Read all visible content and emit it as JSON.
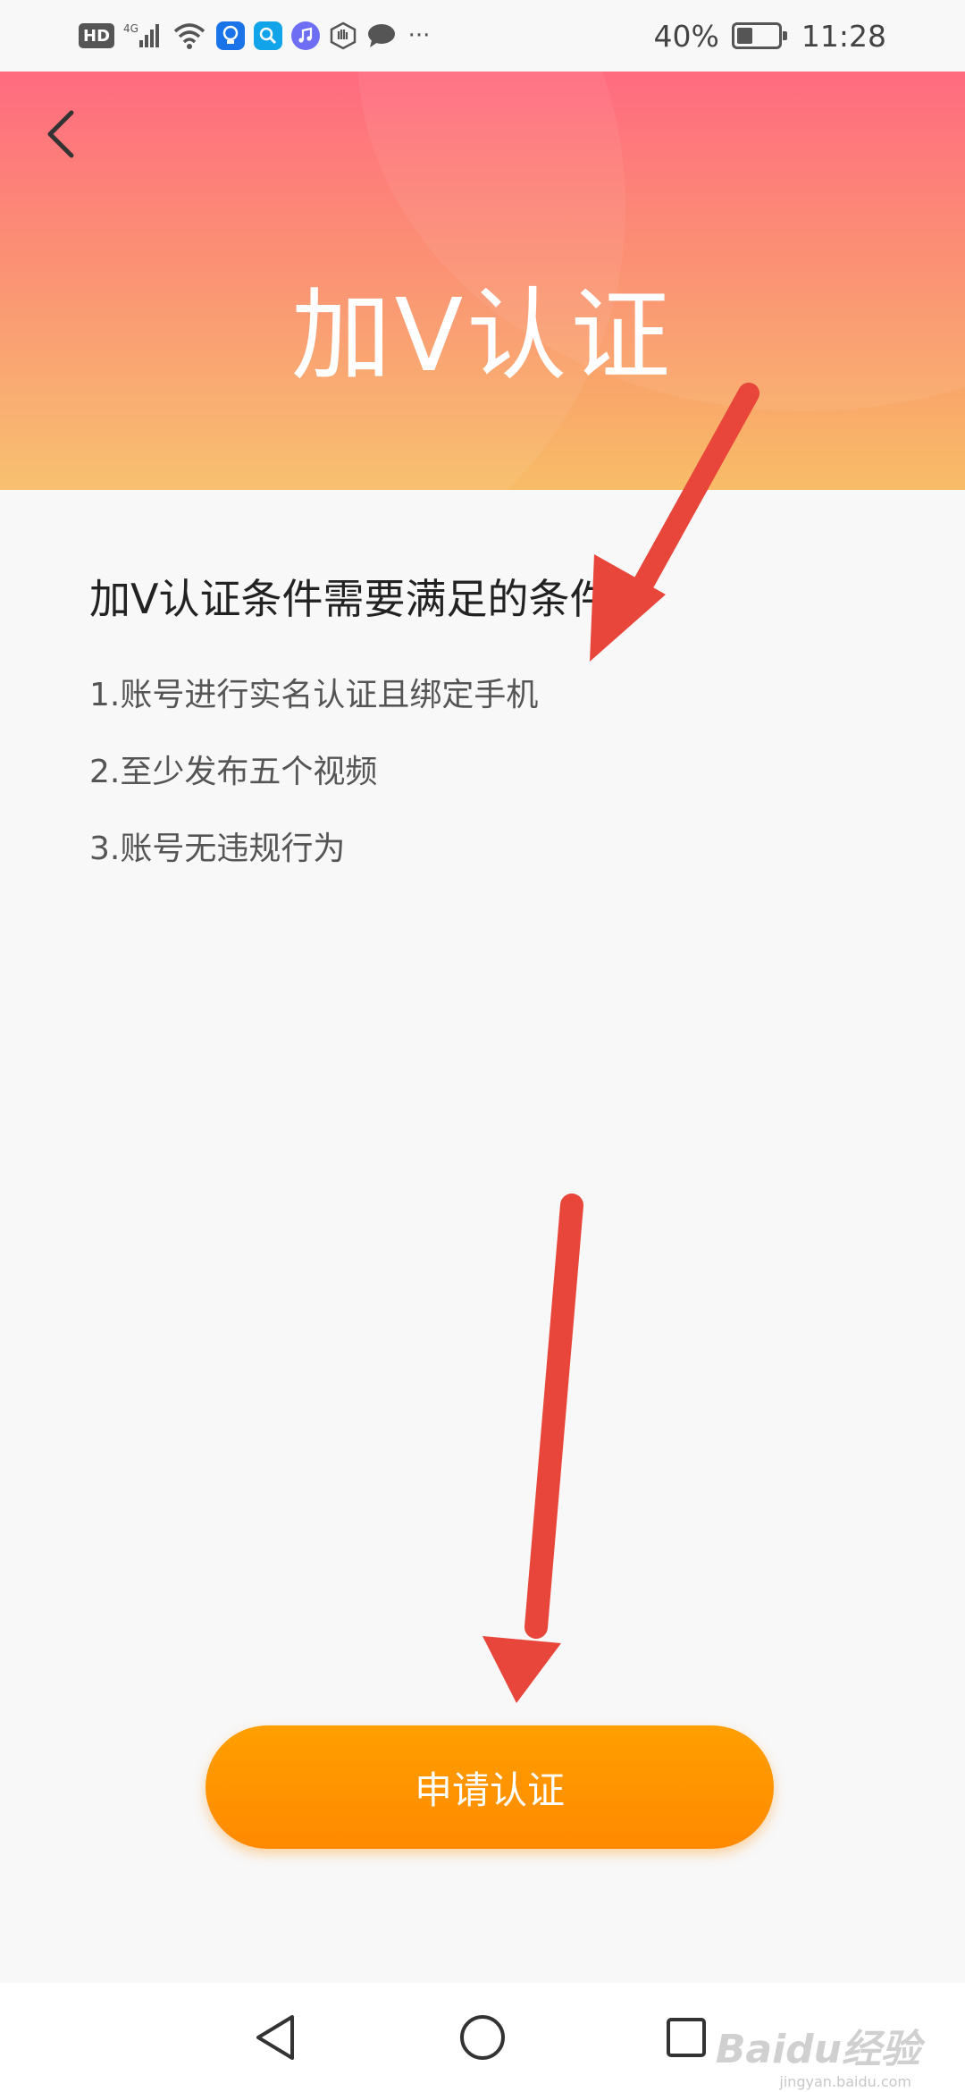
{
  "status_bar": {
    "hd": "HD",
    "network": "4G",
    "battery_percent": "40%",
    "battery_level": 0.4,
    "time": "11:28",
    "more": "···"
  },
  "header": {
    "title": "加V认证",
    "gradient_top": "#ff6278",
    "gradient_bottom": "#f8bd68"
  },
  "content": {
    "heading": "加V认证条件需要满足的条件？",
    "conditions": [
      "1.账号进行实名认证且绑定手机",
      "2.至少发布五个视频",
      "3.账号无违规行为"
    ]
  },
  "actions": {
    "apply_label": "申请认证",
    "apply_color": "#ff9400"
  },
  "annotations": {
    "arrow_color": "#e8463a"
  },
  "watermark": {
    "brand": "Baidu经验",
    "url": "jingyan.baidu.com"
  }
}
